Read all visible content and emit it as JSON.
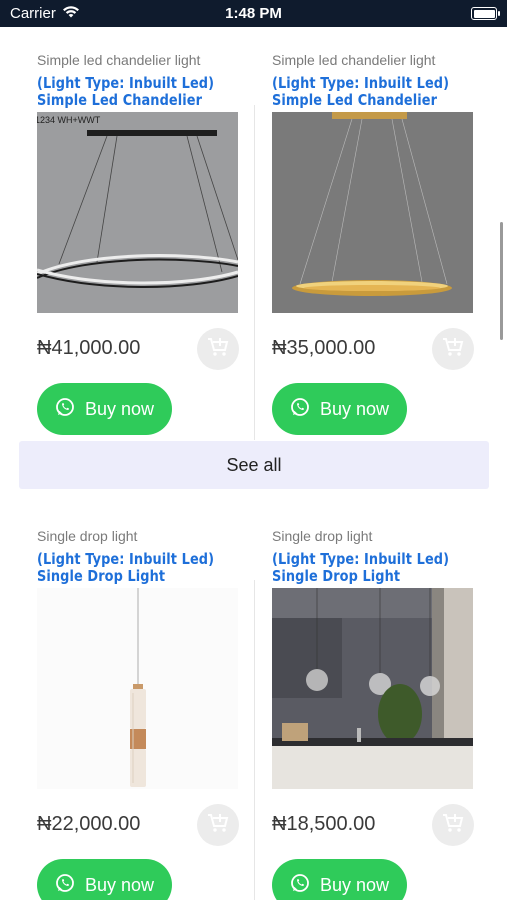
{
  "status_bar": {
    "carrier": "Carrier",
    "time": "1:48 PM"
  },
  "see_all_label": "See all",
  "products": [
    {
      "category": "Simple led chandelier light",
      "title": "(Light Type: Inbuilt Led) Simple Led Chandelier",
      "price": "₦41,000.00",
      "image_caption": "1234 WH+WWT",
      "buy_label": "Buy now"
    },
    {
      "category": "Simple led chandelier light",
      "title": "(Light Type: Inbuilt Led) Simple Led Chandelier",
      "price": "₦35,000.00",
      "buy_label": "Buy now"
    },
    {
      "category": "Single drop light",
      "title": "(Light Type: Inbuilt Led) Single Drop Light",
      "price": "₦22,000.00",
      "buy_label": "Buy now"
    },
    {
      "category": "Single drop light",
      "title": "(Light Type: Inbuilt Led) Single Drop Light",
      "price": "₦18,500.00",
      "buy_label": "Buy now"
    }
  ],
  "colors": {
    "title": "#1e6fd9",
    "buy_button": "#2fcb5a",
    "see_all_bg": "#ededfb",
    "status_bar": "#0f1b2d"
  },
  "icons": [
    "wifi-icon",
    "battery-icon",
    "add-to-cart-icon",
    "whatsapp-icon"
  ]
}
